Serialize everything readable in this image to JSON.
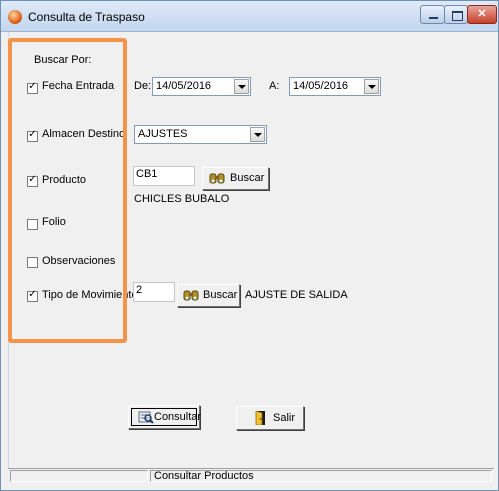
{
  "window": {
    "title": "Consulta de Traspaso",
    "minimize": "minimize-icon",
    "maximize": "maximize-icon",
    "close": "close-icon"
  },
  "filters": {
    "group_label": "Buscar Por:",
    "fecha_entrada": {
      "label": "Fecha Entrada",
      "checked": true
    },
    "almacen_destino": {
      "label": "Almacen Destino",
      "checked": true
    },
    "producto": {
      "label": "Producto",
      "checked": true
    },
    "folio": {
      "label": "Folio",
      "checked": false
    },
    "observaciones": {
      "label": "Observaciones",
      "checked": false
    },
    "tipo_movimiento": {
      "label": "Tipo de Movimiento",
      "checked": true
    }
  },
  "dates": {
    "from_label": "De:",
    "from_value": "14/05/2016",
    "to_label": "A:",
    "to_value": "14/05/2016"
  },
  "almacen": {
    "value": "AJUSTES"
  },
  "producto": {
    "code": "CB1",
    "search_label": "Buscar",
    "description": "CHICLES BUBALO"
  },
  "movimiento": {
    "code": "2",
    "search_label": "Buscar",
    "description": "AJUSTE DE SALIDA"
  },
  "actions": {
    "consultar_label": "Consultar",
    "salir_label": "Salir"
  },
  "status": {
    "cell1": "",
    "cell2": "Consultar Productos"
  },
  "colors": {
    "highlight": "#f4934a",
    "title_bar": "#c2d6ee",
    "close_button": "#c6402c"
  }
}
